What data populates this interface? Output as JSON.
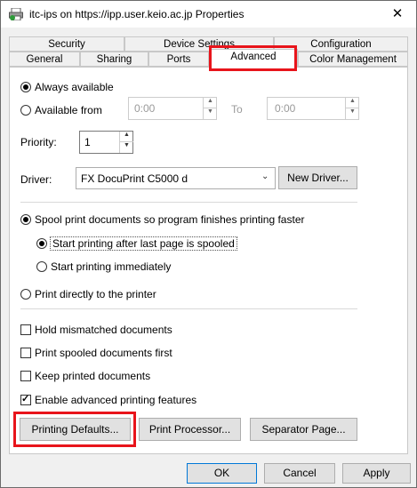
{
  "window": {
    "title": "itc-ips on https://ipp.user.keio.ac.jp Properties",
    "close_glyph": "✕"
  },
  "tabs": {
    "row1": [
      "Security",
      "Device Settings",
      "Configuration"
    ],
    "row2": [
      "General",
      "Sharing",
      "Ports",
      "Advanced",
      "Color Management"
    ]
  },
  "availability": {
    "always_label": "Always available",
    "from_label": "Available from",
    "from_time": "0:00",
    "to_label": "To",
    "to_time": "0:00"
  },
  "priority": {
    "label": "Priority:",
    "value": "1"
  },
  "driver": {
    "label": "Driver:",
    "value": "FX DocuPrint C5000 d",
    "new_driver_label": "New Driver..."
  },
  "spool": {
    "spool_label": "Spool print documents so program finishes printing faster",
    "after_last_label": "Start printing after last page is spooled",
    "immediately_label": "Start printing immediately",
    "direct_label": "Print directly to the printer"
  },
  "options": {
    "hold_mismatched": "Hold mismatched documents",
    "print_spooled_first": "Print spooled documents first",
    "keep_printed": "Keep printed documents",
    "enable_advanced": "Enable advanced printing features"
  },
  "buttons": {
    "printing_defaults": "Printing Defaults...",
    "print_processor": "Print Processor...",
    "separator_page": "Separator Page...",
    "ok": "OK",
    "cancel": "Cancel",
    "apply": "Apply"
  },
  "colors": {
    "highlight": "#e8141b",
    "accent": "#0078d7"
  }
}
